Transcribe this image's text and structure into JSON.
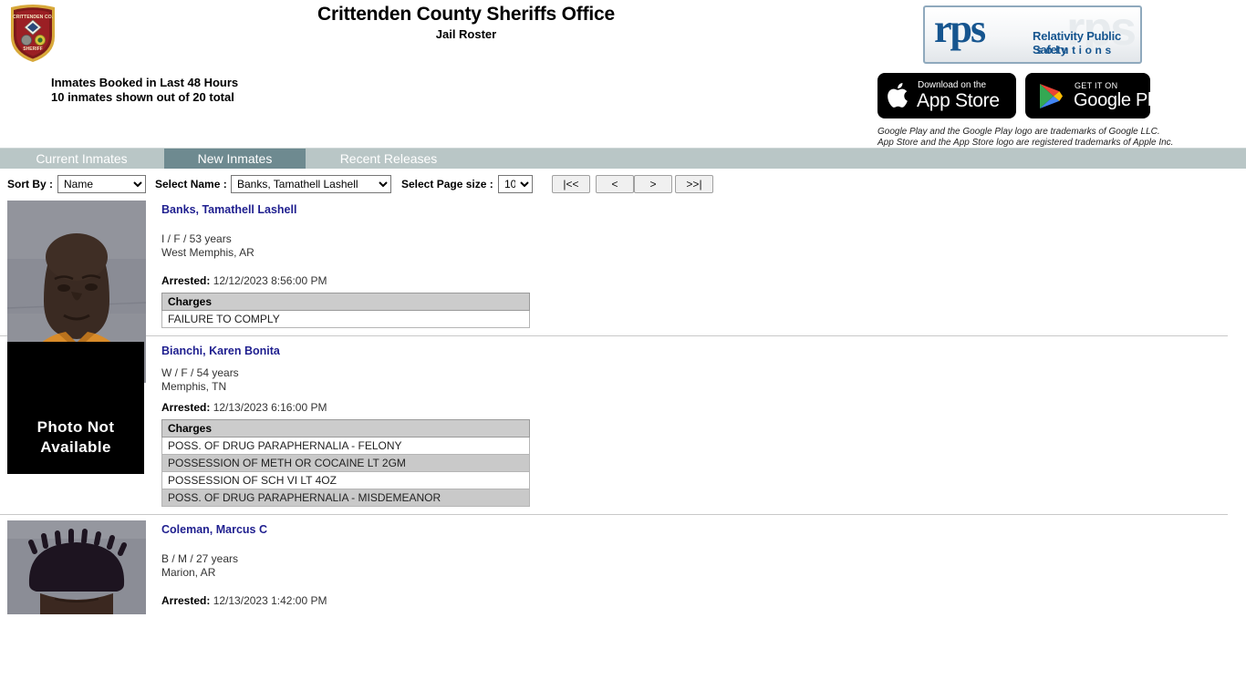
{
  "header": {
    "agency_title": "Crittenden County Sheriffs Office",
    "page_subtitle": "Jail Roster",
    "badge_icon": "sheriff-badge-icon",
    "booked_line1": "Inmates Booked in Last 48 Hours",
    "booked_line2": "10 inmates shown out of 20 total",
    "rps": {
      "mark": "rps",
      "ghost": "rps",
      "line1": "Relativity Public Safety",
      "line2": "solutions"
    },
    "app_store": {
      "small": "Download on the",
      "big": "App Store",
      "icon": "apple-logo-icon"
    },
    "google_play": {
      "small": "GET IT ON",
      "big": "Google Play",
      "icon": "google-play-icon"
    },
    "trademark_line1": "Google Play and the Google Play logo are trademarks of Google LLC.",
    "trademark_line2": "App Store and the App Store logo are registered trademarks of Apple Inc."
  },
  "tabs": [
    {
      "label": "Current Inmates",
      "active": false
    },
    {
      "label": "New Inmates",
      "active": true
    },
    {
      "label": "Recent Releases",
      "active": false
    }
  ],
  "controls": {
    "sort_label": "Sort By :",
    "sort_value": "Name",
    "sort_options": [
      "Name"
    ],
    "name_label": "Select Name :",
    "name_value": "Banks, Tamathell Lashell",
    "name_options": [
      "Banks, Tamathell Lashell"
    ],
    "pagesize_label": "Select Page size :",
    "pagesize_value": "10",
    "pagesize_options": [
      "10"
    ],
    "pager": {
      "first": "|<<",
      "prev": "<",
      "next": ">",
      "last": ">>|"
    }
  },
  "charges_header": "Charges",
  "arrested_label": "Arrested:",
  "no_photo_text": "Photo Not Available",
  "inmates": [
    {
      "name": "Banks, Tamathell Lashell",
      "demographics": "I / F / 53 years",
      "city_state": "West Memphis, AR",
      "arrested": "12/12/2023 8:56:00 PM",
      "has_photo": true,
      "charges": [
        "FAILURE TO COMPLY"
      ]
    },
    {
      "name": "Bianchi, Karen Bonita",
      "demographics": "W / F / 54 years",
      "city_state": "Memphis, TN",
      "arrested": "12/13/2023 6:16:00 PM",
      "has_photo": false,
      "charges": [
        "POSS. OF DRUG PARAPHERNALIA - FELONY",
        "POSSESSION OF METH OR COCAINE LT 2GM",
        "POSSESSION OF SCH VI LT 4OZ",
        "POSS. OF DRUG PARAPHERNALIA - MISDEMEANOR"
      ]
    },
    {
      "name": "Coleman, Marcus C",
      "demographics": "B / M / 27 years",
      "city_state": "Marion, AR",
      "arrested": "12/13/2023 1:42:00 PM",
      "has_photo": true,
      "charges": []
    }
  ],
  "colors": {
    "tabbar_bg": "#b9c6c6",
    "tab_active_bg": "#6e8a90",
    "name_link": "#1f1f8f",
    "charges_header_bg": "#cccccc",
    "charges_alt_row_bg": "#c9c9c9",
    "rps_blue": "#16558f"
  }
}
